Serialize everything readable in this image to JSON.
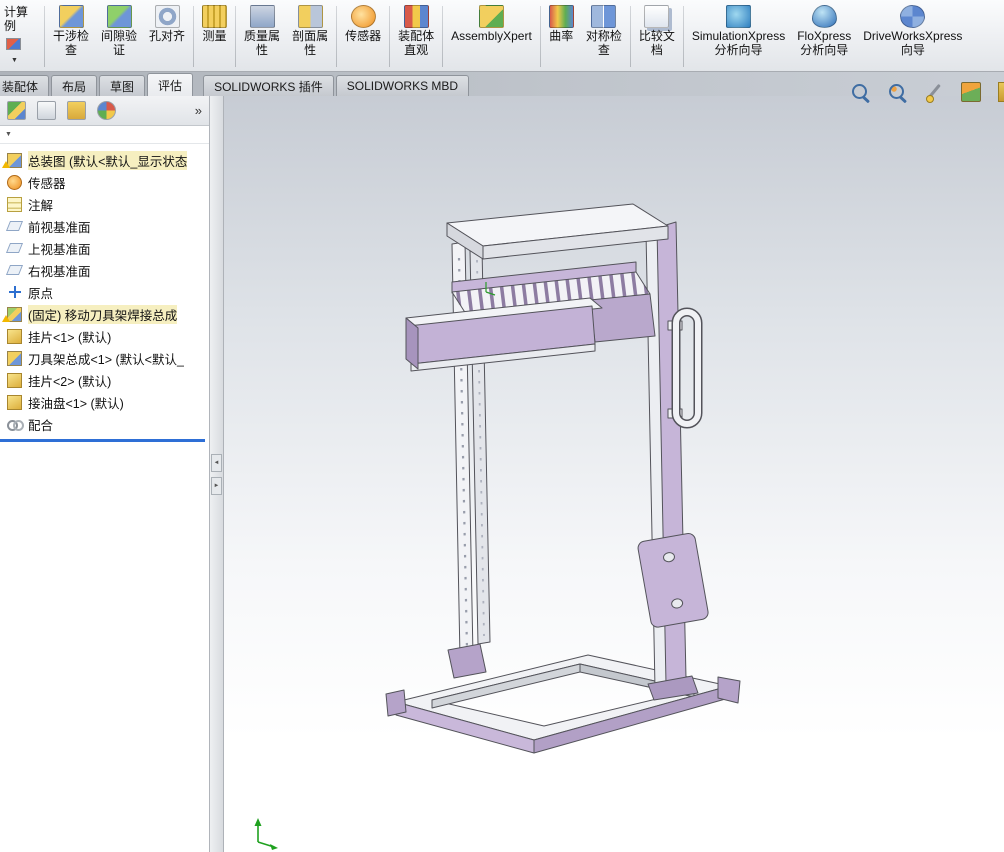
{
  "ribbon": {
    "partial_button": {
      "lines": [
        "计算",
        "例"
      ],
      "dropdown_glyph": "▼"
    },
    "buttons": [
      {
        "id": "interference-check",
        "lines": [
          "干涉检",
          "查"
        ]
      },
      {
        "id": "clearance-verify",
        "lines": [
          "间隙验",
          "证"
        ]
      },
      {
        "id": "hole-alignment",
        "lines": [
          "孔对齐"
        ],
        "sep_after": true
      },
      {
        "id": "measure",
        "lines": [
          "测量"
        ],
        "sep_after": true
      },
      {
        "id": "mass-properties",
        "lines": [
          "质量属",
          "性"
        ]
      },
      {
        "id": "section-properties",
        "lines": [
          "剖面属",
          "性"
        ],
        "sep_after": true
      },
      {
        "id": "sensor",
        "lines": [
          "传感器"
        ],
        "sep_after": true
      },
      {
        "id": "assembly-visualization",
        "lines": [
          "装配体",
          "直观"
        ],
        "sep_after": true
      },
      {
        "id": "assemblyxpert",
        "lines": [
          "AssemblyXpert"
        ],
        "sep_after": true
      },
      {
        "id": "curvature",
        "lines": [
          "曲率"
        ]
      },
      {
        "id": "symmetry-check",
        "lines": [
          "对称检",
          "查"
        ],
        "sep_after": true
      },
      {
        "id": "compare-docs",
        "lines": [
          "比较文",
          "档"
        ],
        "sep_after": true
      },
      {
        "id": "simulationxpress",
        "lines": [
          "SimulationXpress",
          "分析向导"
        ]
      },
      {
        "id": "floxpress",
        "lines": [
          "FloXpress",
          "分析向导"
        ]
      },
      {
        "id": "driveworksxpress",
        "lines": [
          "DriveWorksXpress",
          "向导"
        ]
      }
    ]
  },
  "tabs": {
    "items": [
      {
        "id": "assembly",
        "label": "装配体",
        "active": false
      },
      {
        "id": "layout",
        "label": "布局",
        "active": false
      },
      {
        "id": "sketch",
        "label": "草图",
        "active": false
      },
      {
        "id": "evaluate",
        "label": "评估",
        "active": true
      },
      {
        "id": "solidworks-addins",
        "label": "SOLIDWORKS 插件",
        "active": false
      },
      {
        "id": "solidworks-mbd",
        "label": "SOLIDWORKS MBD",
        "active": false
      }
    ]
  },
  "panel": {
    "tabs": [
      {
        "id": "feature-manager"
      },
      {
        "id": "property-manager"
      },
      {
        "id": "configuration-manager"
      },
      {
        "id": "display-manager"
      }
    ],
    "overflow_glyph": "»",
    "filter_glyph": "▼",
    "tree": [
      {
        "id": "root-assembly",
        "label": "总装图 (默认<默认_显示状态",
        "icon": "assembly",
        "warning": true,
        "highlight": true
      },
      {
        "id": "sensors-folder",
        "label": "传感器",
        "icon": "sensors"
      },
      {
        "id": "annotations-folder",
        "label": "注解",
        "icon": "annotations"
      },
      {
        "id": "front-plane",
        "label": "前视基准面",
        "icon": "plane"
      },
      {
        "id": "top-plane",
        "label": "上视基准面",
        "icon": "plane"
      },
      {
        "id": "right-plane",
        "label": "右视基准面",
        "icon": "plane"
      },
      {
        "id": "origin",
        "label": "原点",
        "icon": "origin"
      },
      {
        "id": "weldment-assembly",
        "label": "(固定) 移动刀具架焊接总成",
        "icon": "weldment",
        "warning": true,
        "highlight": true
      },
      {
        "id": "hanger-plate-1",
        "label": "挂片<1> (默认)",
        "icon": "part"
      },
      {
        "id": "tool-rack-assembly",
        "label": "刀具架总成<1> (默认<默认_",
        "icon": "subassembly"
      },
      {
        "id": "hanger-plate-2",
        "label": "挂片<2> (默认)",
        "icon": "part"
      },
      {
        "id": "oil-pan",
        "label": "接油盘<1> (默认)",
        "icon": "part"
      },
      {
        "id": "mates",
        "label": "配合",
        "icon": "mates"
      }
    ]
  },
  "splitter": {
    "collapse_glyph": "◄",
    "expand_glyph": "►"
  },
  "viewport": {
    "heads_up": [
      {
        "id": "zoom-fit"
      },
      {
        "id": "zoom-area"
      },
      {
        "id": "view-filter"
      },
      {
        "id": "display-style"
      },
      {
        "id": "partial-edge"
      }
    ],
    "colors": {
      "model_purple": "#c6b5d8",
      "model_white": "#f2f3f5",
      "background_top": "#c7ccd4",
      "background_bottom": "#ffffff"
    }
  }
}
